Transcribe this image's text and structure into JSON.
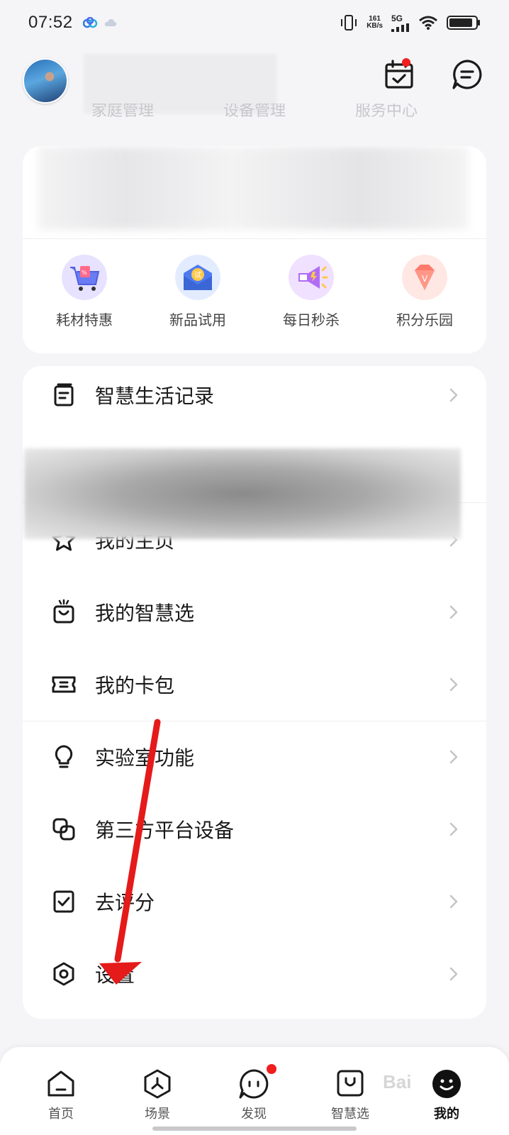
{
  "status_bar": {
    "time": "07:52",
    "net_speed_value": "161",
    "net_speed_unit": "KB/s",
    "network_type": "5G",
    "icons": [
      "baidu-cloud-icon",
      "cloud-icon",
      "vibrate-icon",
      "signal-icon",
      "wifi-icon",
      "battery-icon"
    ]
  },
  "header": {
    "ghost_tabs": [
      "家庭管理",
      "设备管理",
      "服务中心"
    ],
    "icons": [
      "calendar-check-icon",
      "message-icon"
    ],
    "calendar_badge": true
  },
  "quick_actions": [
    {
      "label": "耗材特惠",
      "icon": "shopping-cart-icon",
      "color": "#e7e2ff"
    },
    {
      "label": "新品试用",
      "icon": "envelope-trial-icon",
      "color": "#e3ecff"
    },
    {
      "label": "每日秒杀",
      "icon": "megaphone-icon",
      "color": "#efe1ff"
    },
    {
      "label": "积分乐园",
      "icon": "diamond-icon",
      "color": "#ffe7e3"
    }
  ],
  "menu": {
    "items": [
      {
        "label": "智慧生活记录",
        "icon": "document-icon"
      },
      {
        "label": "我的主页",
        "icon": "star-icon"
      },
      {
        "label": "我的智慧选",
        "icon": "bag-icon"
      },
      {
        "label": "我的卡包",
        "icon": "ticket-icon"
      },
      {
        "label": "实验室功能",
        "icon": "lightbulb-icon"
      },
      {
        "label": "第三方平台设备",
        "icon": "link-devices-icon"
      },
      {
        "label": "去评分",
        "icon": "checkbox-icon"
      },
      {
        "label": "设置",
        "icon": "hexagon-settings-icon"
      }
    ]
  },
  "tabbar": {
    "tabs": [
      {
        "label": "首页",
        "icon": "home-icon",
        "active": false
      },
      {
        "label": "场景",
        "icon": "scene-icon",
        "active": false
      },
      {
        "label": "发现",
        "icon": "discover-icon",
        "active": false,
        "badge": true
      },
      {
        "label": "智慧选",
        "icon": "shop-icon",
        "active": false
      },
      {
        "label": "我的",
        "icon": "profile-icon",
        "active": true
      }
    ]
  },
  "watermark": "Bai"
}
